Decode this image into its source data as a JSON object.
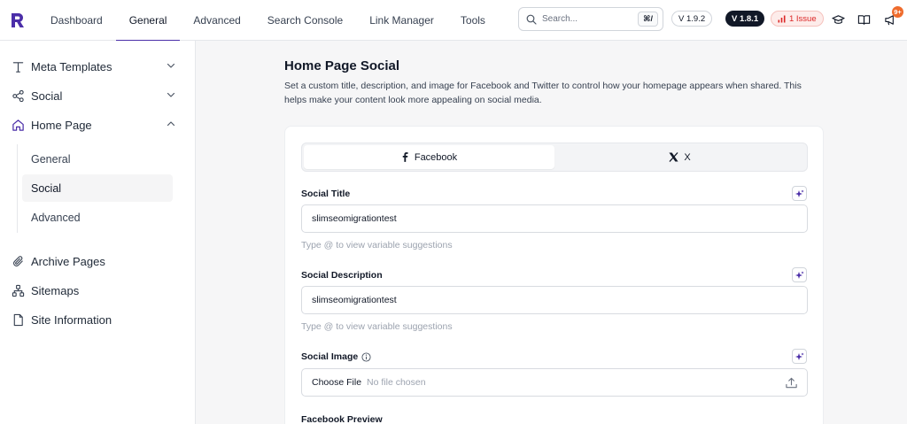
{
  "colors": {
    "brand": "#4b2ea8",
    "issue": "#dc2626",
    "notification": "#ef6c2d"
  },
  "nav": {
    "items": [
      {
        "label": "Dashboard"
      },
      {
        "label": "General"
      },
      {
        "label": "Advanced"
      },
      {
        "label": "Search Console"
      },
      {
        "label": "Link Manager"
      },
      {
        "label": "Tools"
      }
    ],
    "active": "General"
  },
  "search": {
    "placeholder": "Search...",
    "shortcut": "⌘/"
  },
  "badges": {
    "version_free": "V 1.9.2",
    "version_pro": "V 1.8.1",
    "issues": "1 Issue",
    "notifications": "9+"
  },
  "sidebar": {
    "items": [
      {
        "label": "Meta Templates",
        "icon": "text-icon"
      },
      {
        "label": "Social",
        "icon": "share-icon"
      },
      {
        "label": "Home Page",
        "icon": "home-icon"
      },
      {
        "label": "Archive Pages",
        "icon": "paperclip-icon"
      },
      {
        "label": "Sitemaps",
        "icon": "sitemap-icon"
      },
      {
        "label": "Site Information",
        "icon": "file-icon"
      }
    ],
    "sub_items": [
      {
        "label": "General"
      },
      {
        "label": "Social"
      },
      {
        "label": "Advanced"
      }
    ]
  },
  "main": {
    "title": "Home Page Social",
    "description": "Set a custom title, description, and image for Facebook and Twitter to control how your homepage appears when shared. This helps make your content look more appealing on social media.",
    "tabs": [
      {
        "label": "Facebook"
      },
      {
        "label": "X"
      }
    ],
    "social_title": {
      "label": "Social Title",
      "value": "slimseomigrationtest",
      "hint": "Type @ to view variable suggestions"
    },
    "social_description": {
      "label": "Social Description",
      "value": "slimseomigrationtest",
      "hint": "Type @ to view variable suggestions"
    },
    "social_image": {
      "label": "Social Image",
      "choose": "Choose File",
      "no_file": "No file chosen"
    },
    "preview_label": "Facebook Preview"
  }
}
